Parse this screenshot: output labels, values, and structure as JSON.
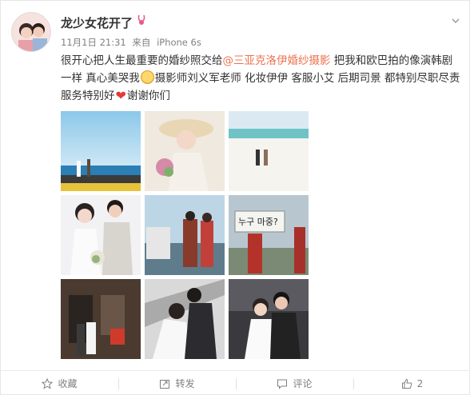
{
  "post": {
    "username": "龙少女花开了",
    "badge_icon": "rabbit-badge-icon",
    "time": "11月1日 21:31",
    "source_prefix": "来自",
    "source": "iPhone 6s",
    "text_part1": "很开心把人生最重要的婚纱照交给",
    "mention": "@三亚克洛伊婚纱摄影",
    "text_part2": " 把我和欧巴拍的像演韩剧一样 真心美哭我",
    "text_part3": "摄影师刘义军老师 化妆伊伊 客服小艾 后期司景 都特别尽职尽责 服务特别好",
    "text_part4": "谢谢你们",
    "heart_glyph": "❤",
    "emoji_1": "crying-emoji-icon",
    "emoji_2": "heart-emoji-icon",
    "photo_count": 9,
    "photos": [
      {
        "name": "photo-beach-sea"
      },
      {
        "name": "photo-bride-hat"
      },
      {
        "name": "photo-white-beach"
      },
      {
        "name": "photo-studio-couple"
      },
      {
        "name": "photo-boat-couple"
      },
      {
        "name": "photo-korean-sign"
      },
      {
        "name": "photo-shop-front"
      },
      {
        "name": "photo-stairs-couple"
      },
      {
        "name": "photo-dark-couple"
      }
    ],
    "sign_text": "누구 마중?"
  },
  "footer": {
    "favorite_label": "收藏",
    "repost_label": "转发",
    "comment_label": "评论",
    "like_count": "2"
  },
  "colors": {
    "mention": "#eb7350",
    "meta": "#808080",
    "text": "#333333"
  }
}
